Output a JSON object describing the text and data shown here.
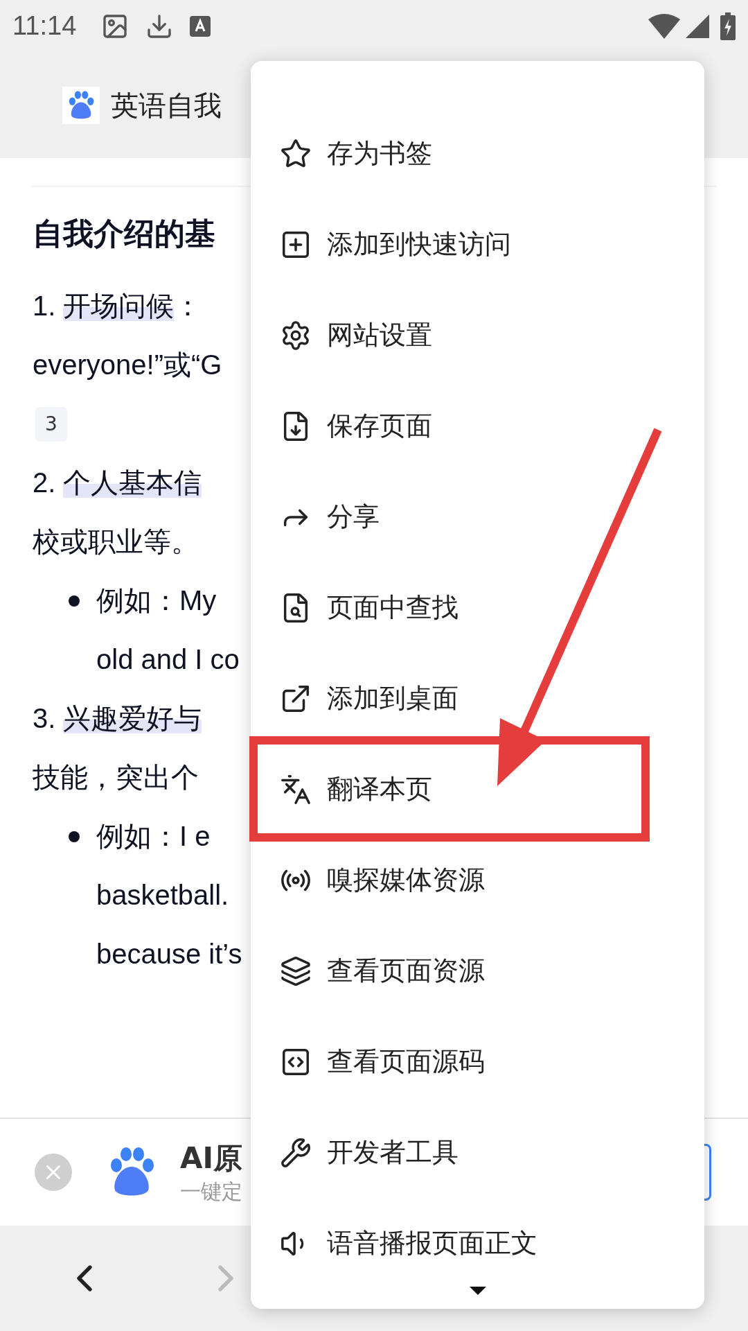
{
  "status_bar": {
    "time": "11:14"
  },
  "header": {
    "title": "英语自我"
  },
  "article": [
    {
      "kind": "heading",
      "text": "自我介绍的基"
    },
    {
      "kind": "numbered",
      "number": "1.",
      "highlight": "开场问候",
      "rest": "："
    },
    {
      "kind": "text",
      "text": "everyone!”或“G"
    },
    {
      "kind": "badge",
      "text": "3"
    },
    {
      "kind": "numbered",
      "number": "2.",
      "highlight": "个人基本信"
    },
    {
      "kind": "text",
      "text": "校或职业等。"
    },
    {
      "kind": "bullet",
      "text": "例如：My"
    },
    {
      "kind": "continued",
      "text": "old and I co"
    },
    {
      "kind": "numbered",
      "number": "3.",
      "highlight": "兴趣爱好与"
    },
    {
      "kind": "text",
      "text": "技能，突出个"
    },
    {
      "kind": "bullet",
      "text": "例如：I e"
    },
    {
      "kind": "continued",
      "text": "basketball."
    },
    {
      "kind": "continued",
      "text": "because it’s"
    }
  ],
  "banner": {
    "title": "AI原",
    "subtitle": "一键定"
  },
  "menu": {
    "items": [
      {
        "label": "存为书签",
        "annotated": false
      },
      {
        "label": "添加到快速访问",
        "annotated": false
      },
      {
        "label": "网站设置",
        "annotated": false
      },
      {
        "label": "保存页面",
        "annotated": false
      },
      {
        "label": "分享",
        "annotated": false
      },
      {
        "label": "页面中查找",
        "annotated": false
      },
      {
        "label": "添加到桌面",
        "annotated": false
      },
      {
        "label": "翻译本页",
        "annotated": true
      },
      {
        "label": "嗅探媒体资源",
        "annotated": false
      },
      {
        "label": "查看页面资源",
        "annotated": false
      },
      {
        "label": "查看页面源码",
        "annotated": false
      },
      {
        "label": "开发者工具",
        "annotated": false
      },
      {
        "label": "语音播报页面正文",
        "annotated": false
      }
    ]
  }
}
